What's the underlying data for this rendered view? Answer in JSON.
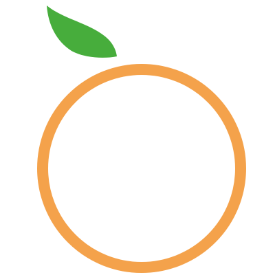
{
  "logo": {
    "icon": "orange-fruit-icon",
    "colors": {
      "background": "#ffffff",
      "ring": "#f4a24b",
      "leaf": "#47ad3c"
    }
  }
}
